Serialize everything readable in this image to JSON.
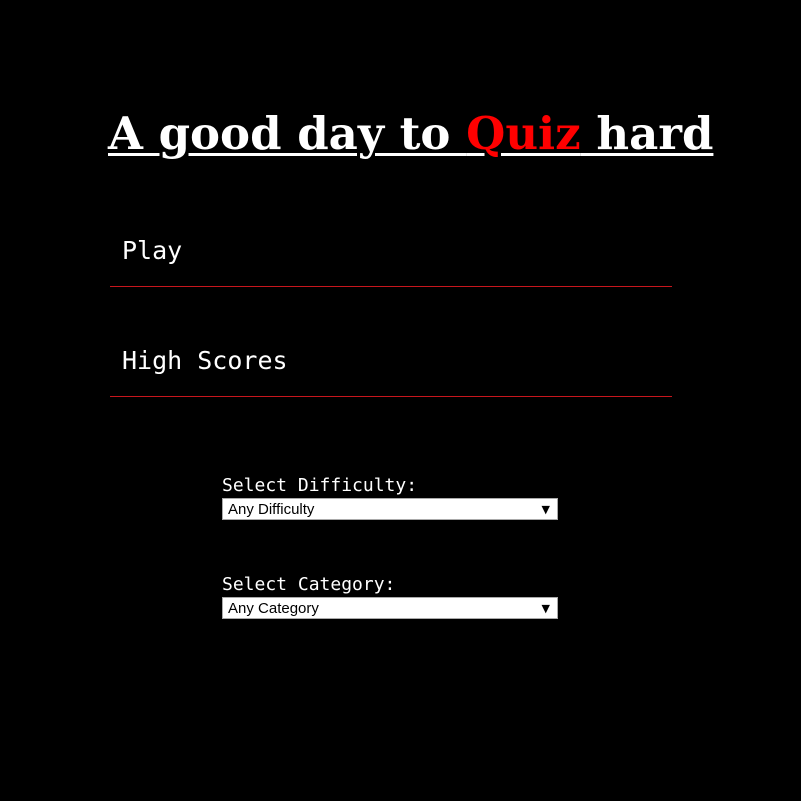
{
  "title": {
    "part1": "A good day to ",
    "accent": "Quiz",
    "part2": " hard",
    "accent_color": "#ff0000"
  },
  "menu": {
    "play_label": "Play",
    "highscores_label": "High Scores",
    "underline_color": "#c8161d"
  },
  "difficulty": {
    "label": "Select Difficulty:",
    "selected": "Any Difficulty"
  },
  "category": {
    "label": "Select Category:",
    "selected": "Any Category"
  },
  "icons": {
    "dropdown": "chevron-down-icon"
  }
}
